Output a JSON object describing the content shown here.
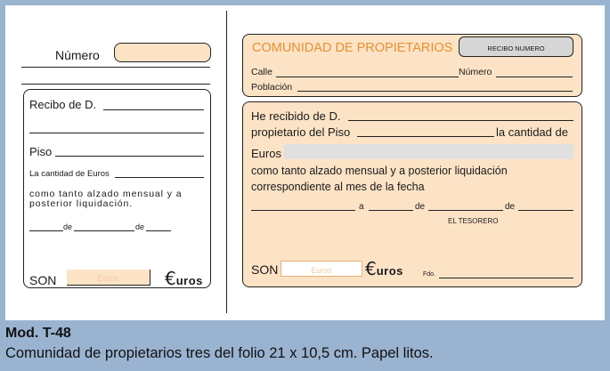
{
  "stub": {
    "numero_label": "Número",
    "recibo_label": "Recibo de D.",
    "piso_label": "Piso",
    "cantidad_label": "La cantidad de Euros",
    "concepto": "como tanto alzado mensual y a posterior liquidación.",
    "date_de1": "de",
    "date_de2": "de",
    "son_label": "SON",
    "son_placeholder": "Euros",
    "euro_symbol": "€",
    "euros_word": "uros"
  },
  "receipt": {
    "title": "COMUNIDAD DE PROPIETARIOS",
    "recibo_numero": "RECIBO NUMERO",
    "calle_label": "Calle",
    "numero_label": "Número",
    "poblacion_label": "Población",
    "he_recibido": "He recibido de D.",
    "propietario_piso": "propietario del Piso",
    "la_cantidad_de": "la cantidad de",
    "euros_label": "Euros",
    "concepto": "como tanto alzado mensual y a posterior liquidación correspondiente al mes de la fecha",
    "date_a": "a",
    "date_de1": "de",
    "date_de2": "de",
    "tesorero": "EL TESORERO",
    "son_label": "SON",
    "son_placeholder": "Euros",
    "euro_symbol": "€",
    "euros_word": "uros",
    "fdo": "Fdo."
  },
  "caption": {
    "model": "Mod. T-48",
    "description": "Comunidad de propietarios tres del folio 21 x 10,5 cm. Papel litos."
  },
  "colors": {
    "background": "#9ab3d1",
    "peach": "#fde3c6",
    "accent_title": "#e8902f",
    "stamp_grey": "#d6d6d6"
  }
}
